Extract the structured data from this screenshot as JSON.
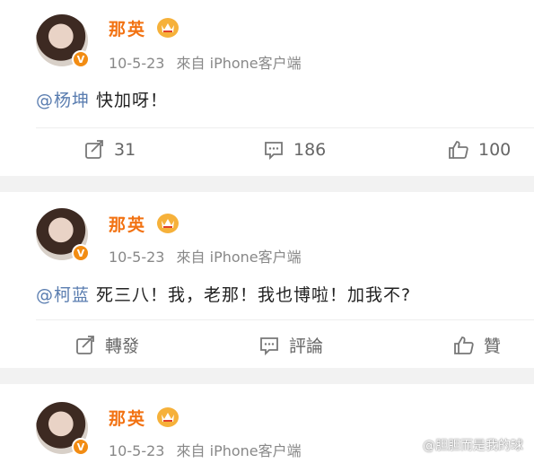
{
  "posts": [
    {
      "username": "那英",
      "date": "10-5-23",
      "source": "來自 iPhone客户端",
      "mention": "@杨坤",
      "text": " 快加呀！",
      "actions": {
        "repost": "31",
        "comment": "186",
        "like": "100"
      }
    },
    {
      "username": "那英",
      "date": "10-5-23",
      "source": "來自 iPhone客户端",
      "mention": "@柯蓝",
      "text": " 死三八！我，老那！我也博啦！加我不?",
      "actions": {
        "repost": "轉發",
        "comment": "評論",
        "like": "贊"
      }
    },
    {
      "username": "那英",
      "date": "10-5-23",
      "source": "來自 iPhone客户端"
    }
  ],
  "badge_text": "V",
  "watermark": "@胆胆而是我的球",
  "colors": {
    "username": "#f27212",
    "mention": "#5a7db0",
    "badge": "#f28c13"
  }
}
